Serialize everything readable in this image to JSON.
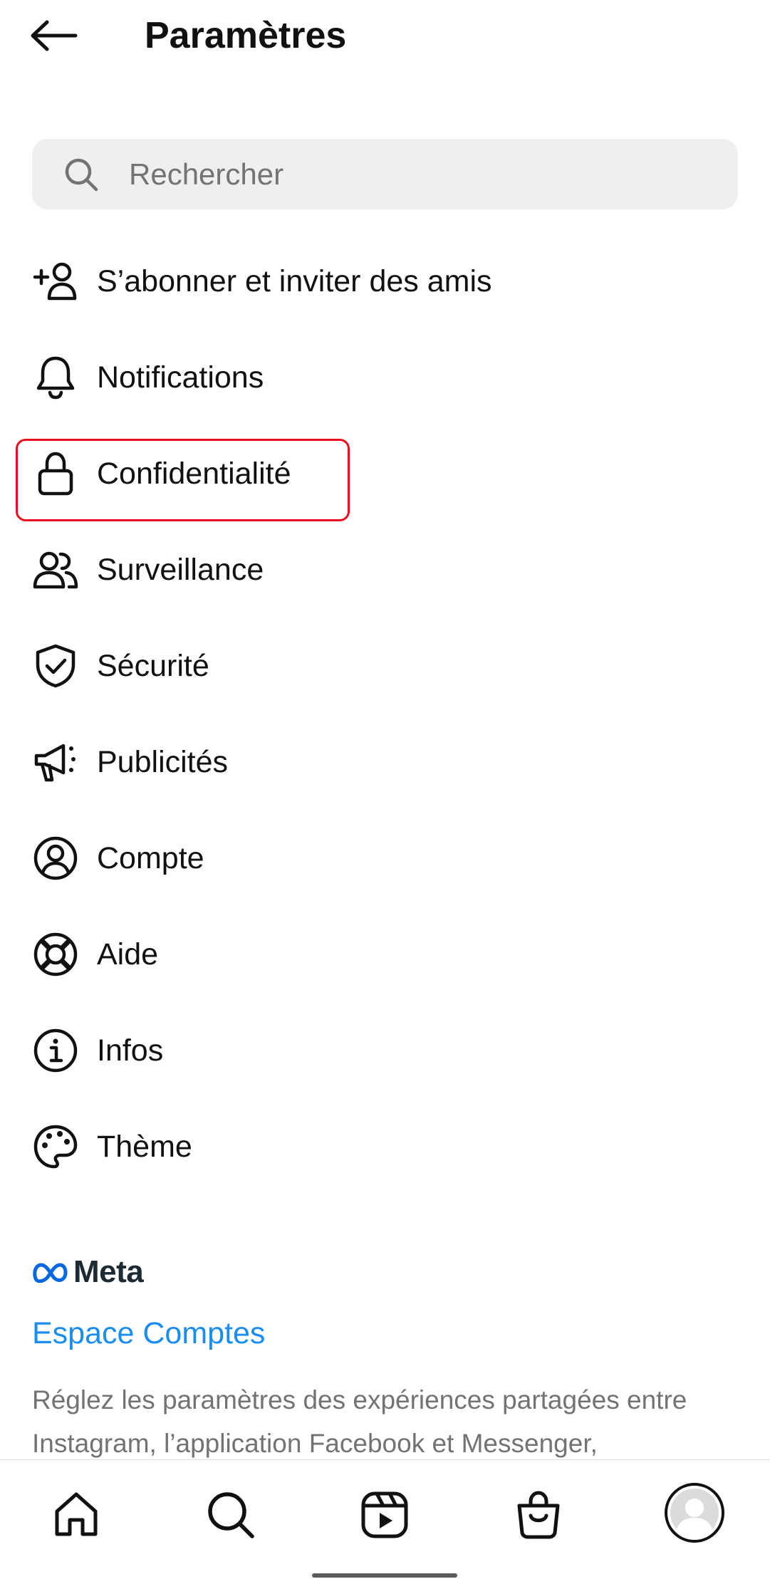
{
  "header": {
    "title": "Paramètres",
    "back_icon": "arrow-left-icon"
  },
  "search": {
    "placeholder": "Rechercher",
    "value": "",
    "icon": "search-icon"
  },
  "menu": {
    "items": [
      {
        "label": "S’abonner et inviter des amis",
        "icon": "add-person-icon"
      },
      {
        "label": "Notifications",
        "icon": "bell-icon"
      },
      {
        "label": "Confidentialité",
        "icon": "lock-icon",
        "highlighted": true
      },
      {
        "label": "Surveillance",
        "icon": "people-icon"
      },
      {
        "label": "Sécurité",
        "icon": "shield-check-icon"
      },
      {
        "label": "Publicités",
        "icon": "megaphone-icon"
      },
      {
        "label": "Compte",
        "icon": "account-circle-icon"
      },
      {
        "label": "Aide",
        "icon": "lifebuoy-icon"
      },
      {
        "label": "Infos",
        "icon": "info-icon"
      },
      {
        "label": "Thème",
        "icon": "palette-icon"
      }
    ]
  },
  "meta_section": {
    "logo_text": "Meta",
    "link_label": "Espace Comptes",
    "description": "Réglez les paramètres des expériences partagées entre Instagram, l’application Facebook et Messenger,"
  },
  "bottom_nav": {
    "items": [
      "home-icon",
      "search-icon",
      "reels-icon",
      "shop-icon",
      "profile-avatar"
    ]
  },
  "colors": {
    "text": "#111111",
    "secondary_text": "#737373",
    "link": "#1a8ef0",
    "highlight_border": "#ea0f1e",
    "search_bg": "#efefef"
  }
}
